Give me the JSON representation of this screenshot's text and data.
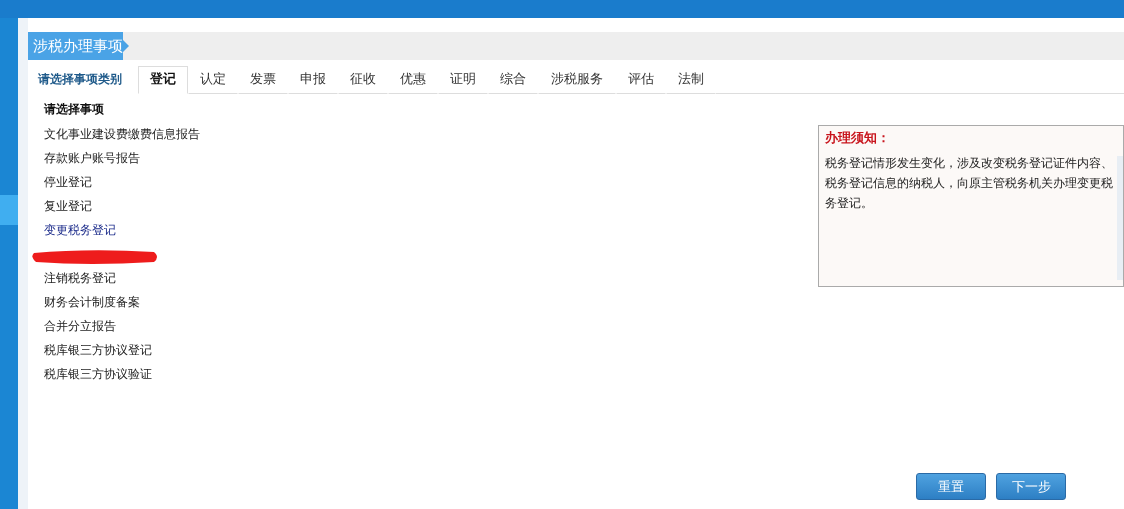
{
  "section_title": "涉税办理事项",
  "tabs_label": "请选择事项类别",
  "tabs": [
    {
      "label": "登记",
      "selected": true
    },
    {
      "label": "认定",
      "selected": false
    },
    {
      "label": "发票",
      "selected": false
    },
    {
      "label": "申报",
      "selected": false
    },
    {
      "label": "征收",
      "selected": false
    },
    {
      "label": "优惠",
      "selected": false
    },
    {
      "label": "证明",
      "selected": false
    },
    {
      "label": "综合",
      "selected": false
    },
    {
      "label": "涉税服务",
      "selected": false
    },
    {
      "label": "评估",
      "selected": false
    },
    {
      "label": "法制",
      "selected": false
    }
  ],
  "items_heading": "请选择事项",
  "items": [
    {
      "kind": "item",
      "label": "文化事业建设费缴费信息报告",
      "selected": false
    },
    {
      "kind": "item",
      "label": "存款账户账号报告",
      "selected": false
    },
    {
      "kind": "item",
      "label": "停业登记",
      "selected": false
    },
    {
      "kind": "item",
      "label": "复业登记",
      "selected": false
    },
    {
      "kind": "item",
      "label": "变更税务登记",
      "selected": true
    },
    {
      "kind": "redacted"
    },
    {
      "kind": "item",
      "label": "注销税务登记",
      "selected": false
    },
    {
      "kind": "item",
      "label": "财务会计制度备案",
      "selected": false
    },
    {
      "kind": "item",
      "label": "合并分立报告",
      "selected": false
    },
    {
      "kind": "item",
      "label": "税库银三方协议登记",
      "selected": false
    },
    {
      "kind": "item",
      "label": "税库银三方协议验证",
      "selected": false
    }
  ],
  "notice": {
    "title": "办理须知：",
    "text": "税务登记情形发生变化，涉及改变税务登记证件内容、税务登记信息的纳税人，向原主管税务机关办理变更税务登记。"
  },
  "buttons": [
    "重置",
    "下一步"
  ]
}
